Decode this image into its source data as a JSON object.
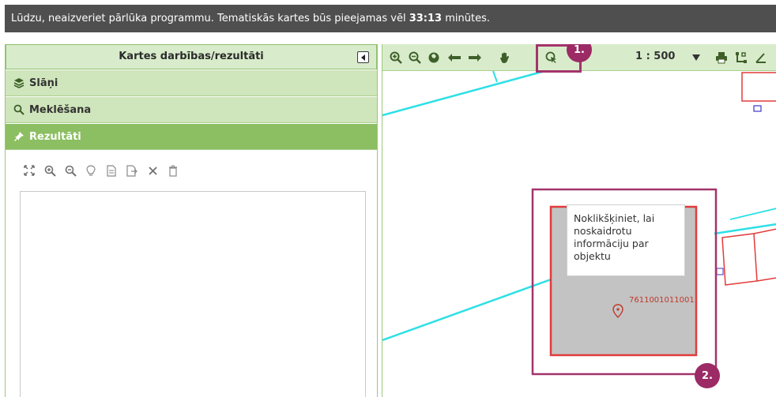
{
  "notice": {
    "text_before": "Lūdzu, neaizveriet pārlūka programmu. Tematiskās kartes būs pieejamas vēl ",
    "time": "33:13",
    "text_after": " minūtes."
  },
  "left_panel": {
    "title": "Kartes darbības/rezultāti",
    "accordion": [
      {
        "label": "Slāņi",
        "icon": "layers-icon"
      },
      {
        "label": "Meklēšana",
        "icon": "search-icon"
      },
      {
        "label": "Rezultāti",
        "icon": "pin-icon"
      }
    ],
    "results_toolbar": [
      "expand-icon",
      "zoom-in-icon",
      "zoom-out-icon",
      "bulb-icon",
      "document-icon",
      "document-export-icon",
      "close-icon",
      "trash-icon"
    ]
  },
  "map": {
    "scale": "1 : 500",
    "tooltip": "Noklikšķiniet, lai noskaidrotu informāciju par objektu",
    "parcel_id": "7611001011001",
    "badges": [
      "1.",
      "2."
    ],
    "colors": {
      "accent": "#9b2a65",
      "panel_green": "#8cbe62",
      "light_green": "#d8eccb",
      "line_cyan": "#2de0e6",
      "parcel_red": "#e23b3b",
      "selection": "#a3346b"
    }
  }
}
